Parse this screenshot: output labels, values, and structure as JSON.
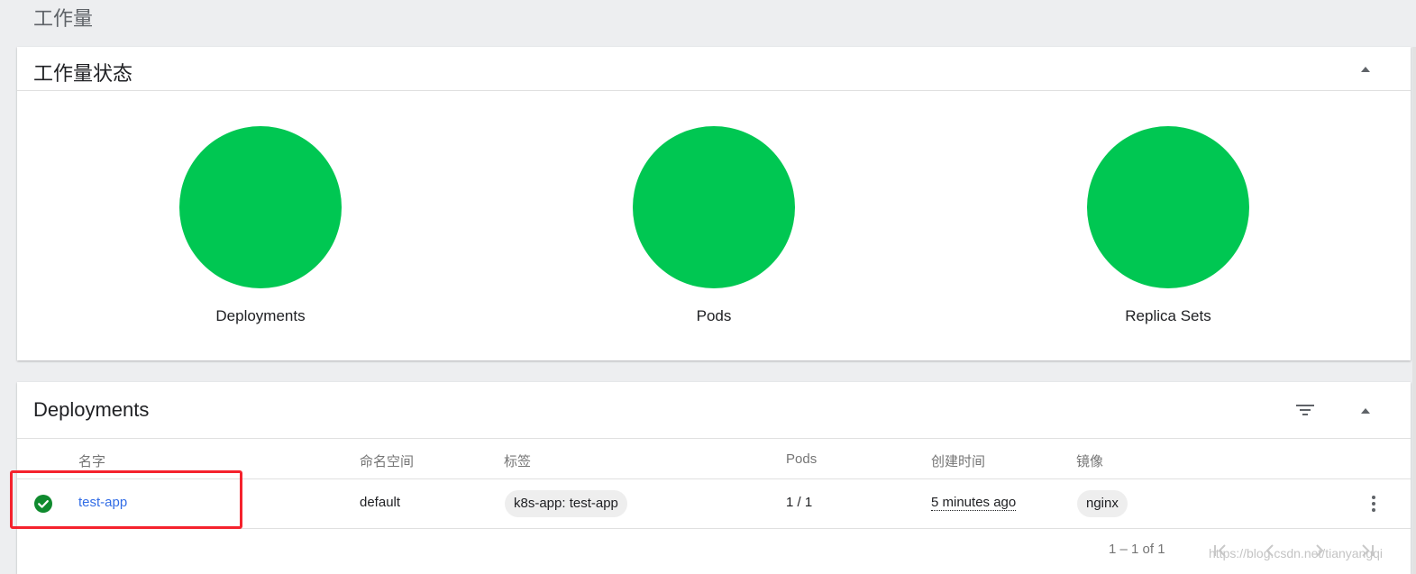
{
  "page": {
    "title": "工作量"
  },
  "status_card": {
    "title": "工作量状态",
    "charts": [
      {
        "label": "Deployments",
        "status": "running",
        "fraction_running": 1.0
      },
      {
        "label": "Pods",
        "status": "running",
        "fraction_running": 1.0
      },
      {
        "label": "Replica Sets",
        "status": "running",
        "fraction_running": 1.0
      }
    ],
    "running_color": "#00c752"
  },
  "deployments_card": {
    "title": "Deployments",
    "columns": {
      "name": "名字",
      "namespace": "命名空间",
      "labels": "标签",
      "pods": "Pods",
      "created": "创建时间",
      "images": "镜像"
    },
    "rows": [
      {
        "status": "check-circle-icon",
        "name": "test-app",
        "namespace": "default",
        "label": "k8s-app: test-app",
        "pods": "1 / 1",
        "created": "5 minutes ago",
        "image": "nginx"
      }
    ],
    "pagination": {
      "range_text": "1 – 1 of 1"
    }
  },
  "watermark": "https://blog.csdn.net/tianyangqi",
  "colors": {
    "accent_link": "#326de6",
    "success": "#00c752",
    "highlight": "#f5222d"
  }
}
